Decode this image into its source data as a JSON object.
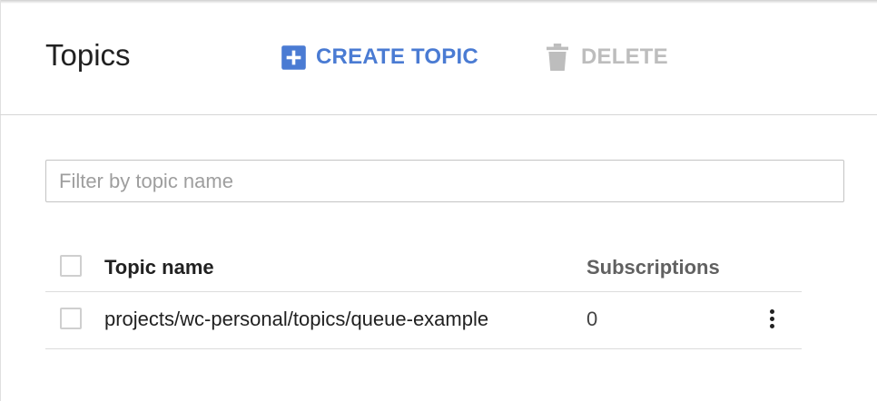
{
  "header": {
    "title": "Topics",
    "create_label": "CREATE TOPIC",
    "delete_label": "DELETE"
  },
  "filter": {
    "placeholder": "Filter by topic name",
    "value": ""
  },
  "table": {
    "columns": [
      "Topic name",
      "Subscriptions"
    ],
    "rows": [
      {
        "name": "projects/wc-personal/topics/queue-example",
        "subscriptions": "0"
      }
    ]
  },
  "colors": {
    "accent": "#4a7bd3",
    "disabled": "#bdbdbd",
    "divider": "#dcdcdc"
  },
  "icons": [
    "add-box-icon",
    "trash-icon",
    "more-vert-icon"
  ]
}
